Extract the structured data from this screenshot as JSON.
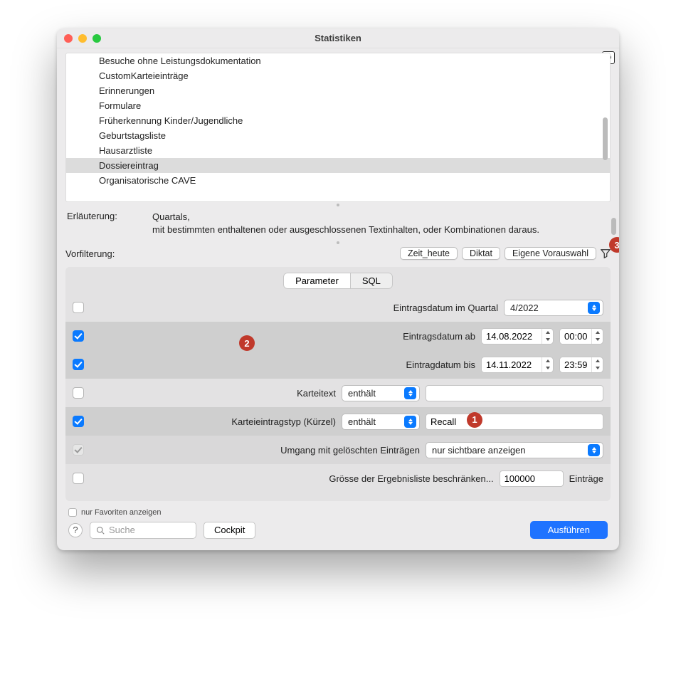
{
  "window": {
    "title": "Statistiken"
  },
  "list": {
    "items": [
      "Besuche ohne Leistungsdokumentation",
      "CustomKarteieinträge",
      "Erinnerungen",
      "Formulare",
      "Früherkennung Kinder/Jugendliche",
      "Geburtstagsliste",
      "Hausarztliste",
      "Dossiereintrag",
      "Organisatorische CAVE"
    ],
    "selected_index": 7
  },
  "explanation": {
    "label": "Erläuterung:",
    "line1": "Quartals,",
    "line2": "mit bestimmten enthaltenen oder ausgeschlossenen Textinhalten, oder Kombinationen daraus."
  },
  "prefilter": {
    "label": "Vorfilterung:",
    "buttons": [
      "Zeit_heute",
      "Diktat",
      "Eigene Vorauswahl"
    ]
  },
  "tabs": {
    "parameter": "Parameter",
    "sql": "SQL",
    "active": "parameter"
  },
  "params": {
    "row_quartal": {
      "checked": false,
      "label": "Eintragsdatum im Quartal",
      "select": "4/2022"
    },
    "row_ab": {
      "checked": true,
      "label": "Eintragsdatum ab",
      "date": "14.08.2022",
      "time": "00:00"
    },
    "row_bis": {
      "checked": true,
      "label": "Eintragdatum bis",
      "date": "14.11.2022",
      "time": "23:59"
    },
    "row_karteitext": {
      "checked": false,
      "label": "Karteitext",
      "op": "enthält",
      "value": ""
    },
    "row_typ": {
      "checked": true,
      "label": "Karteieintragstyp (Kürzel)",
      "op": "enthält",
      "value": "Recall"
    },
    "row_deleted": {
      "checked": true,
      "disabled": true,
      "label": "Umgang mit gelöschten Einträgen",
      "select": "nur sichtbare anzeigen"
    },
    "row_limit": {
      "checked": false,
      "label": "Grösse der Ergebnisliste beschränken...",
      "value": "100000",
      "suffix": "Einträge"
    }
  },
  "footer": {
    "favorites_label": "nur Favoriten anzeigen",
    "search_placeholder": "Suche",
    "cockpit": "Cockpit",
    "execute": "Ausführen"
  },
  "annotations": {
    "a1": "1",
    "a2": "2",
    "a3": "3"
  }
}
